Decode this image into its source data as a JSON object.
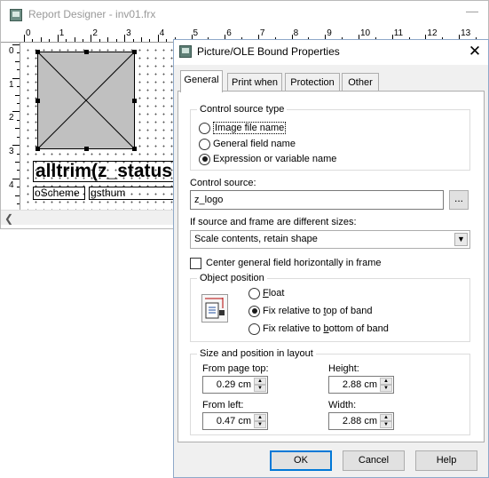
{
  "report_designer": {
    "title": "Report Designer - inv01.frx",
    "minimize_glyph": "—",
    "ruler_h": [
      "0",
      "1",
      "2",
      "3",
      "4",
      "5",
      "6",
      "7",
      "8",
      "9",
      "10",
      "11",
      "12",
      "13"
    ],
    "ruler_v": [
      "0",
      "1",
      "2",
      "3",
      "4"
    ],
    "canvas": {
      "expression_text": "alltrim(z_status",
      "field1_text": "oScheme",
      "field2_text": "gsthum"
    }
  },
  "dialog": {
    "title": "Picture/OLE Bound Properties",
    "close_glyph": "✕",
    "tabs": [
      {
        "label": "General",
        "active": true
      },
      {
        "label": "Print when",
        "active": false
      },
      {
        "label": "Protection",
        "active": false
      },
      {
        "label": "Other",
        "active": false
      }
    ],
    "control_source_type": {
      "label": "Control source type",
      "options": [
        {
          "label": "Image file name",
          "selected": false
        },
        {
          "label": "General field name",
          "selected": false
        },
        {
          "label": "Expression or variable name",
          "selected": true
        }
      ]
    },
    "control_source": {
      "label": "Control source:",
      "value": "z_logo",
      "button": "..."
    },
    "size_mismatch": {
      "label": "If source and frame are different sizes:",
      "value": "Scale contents, retain shape"
    },
    "center_checkbox": {
      "label": "Center general field horizontally in frame",
      "checked": false
    },
    "object_position": {
      "label": "Object position",
      "options": [
        {
          "label_pre": "",
          "label_u": "F",
          "label_post": "loat",
          "selected": false
        },
        {
          "label_pre": "Fix relative to ",
          "label_u": "t",
          "label_post": "op of band",
          "selected": true
        },
        {
          "label_pre": "Fix relative to ",
          "label_u": "b",
          "label_post": "ottom of band",
          "selected": false
        }
      ]
    },
    "size_position": {
      "label": "Size and position in layout",
      "from_page_top": {
        "label": "From page top:",
        "value": "0.29 cm"
      },
      "height": {
        "label": "Height:",
        "value": "2.88 cm"
      },
      "from_left": {
        "label": "From left:",
        "value": "0.47 cm"
      },
      "width": {
        "label": "Width:",
        "value": "2.88 cm"
      }
    },
    "buttons": {
      "ok": "OK",
      "cancel": "Cancel",
      "help": "Help"
    },
    "colors": {
      "accent": "#0078d7",
      "panel": "#ffffff",
      "chrome": "#f0f0f0"
    }
  }
}
